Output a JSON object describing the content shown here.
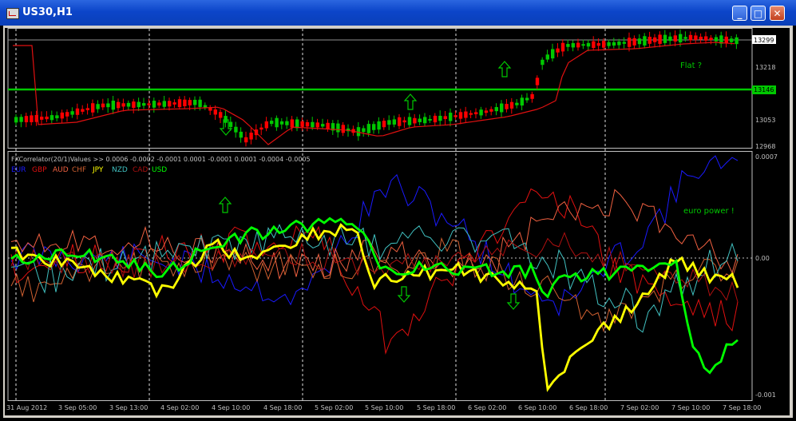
{
  "window": {
    "title": "US30,H1",
    "minimize_glyph": "_",
    "maximize_glyph": "□",
    "close_glyph": "✕"
  },
  "price_panel": {
    "price_scale": [
      "13218",
      "13053",
      "12968"
    ],
    "current_price": "13299",
    "horizontal_line_price": "13146",
    "annotation": "Flat ?",
    "colors": {
      "up_candle": "#00c800",
      "down_candle": "#ff0000",
      "moving_average": "#e01010",
      "level_line": "#00c800",
      "annotation": "#00c800"
    }
  },
  "indicator_panel": {
    "header": "FXCorrelator(20/1)Values >> 0.0006 -0.0002 -0.0001 0.0001 -0.0001 0.0001 -0.0004 -0.0005",
    "legend": [
      {
        "label": "EUR",
        "color": "#1a1aff"
      },
      {
        "label": "GBP",
        "color": "#e01010"
      },
      {
        "label": "AUD",
        "color": "#f06040"
      },
      {
        "label": "CHF",
        "color": "#d06030"
      },
      {
        "label": "JPY",
        "color": "#ffff00"
      },
      {
        "label": "NZD",
        "color": "#40c0c0"
      },
      {
        "label": "CAD",
        "color": "#b01010"
      },
      {
        "label": "USD",
        "color": "#00ff00"
      }
    ],
    "scale": [
      "0.0007",
      "0.00",
      "-0.001"
    ],
    "annotation": "euro power !",
    "annotation_color": "#00c800"
  },
  "time_axis": [
    "31 Aug 2012",
    "3 Sep 05:00",
    "3 Sep 13:00",
    "4 Sep 02:00",
    "4 Sep 10:00",
    "4 Sep 18:00",
    "5 Sep 02:00",
    "5 Sep 10:00",
    "5 Sep 18:00",
    "6 Sep 02:00",
    "6 Sep 10:00",
    "6 Sep 18:00",
    "7 Sep 02:00",
    "7 Sep 10:00",
    "7 Sep 18:00"
  ],
  "arrow_icons": [
    {
      "panel": "price",
      "direction": "down",
      "icon": "arrow-down-icon"
    },
    {
      "panel": "price",
      "direction": "up",
      "icon": "arrow-up-icon"
    },
    {
      "panel": "price",
      "direction": "up",
      "icon": "arrow-up-icon"
    },
    {
      "panel": "indicator",
      "direction": "up",
      "icon": "arrow-up-icon"
    },
    {
      "panel": "indicator",
      "direction": "down",
      "icon": "arrow-down-icon"
    },
    {
      "panel": "indicator",
      "direction": "down",
      "icon": "arrow-down-icon"
    }
  ]
}
